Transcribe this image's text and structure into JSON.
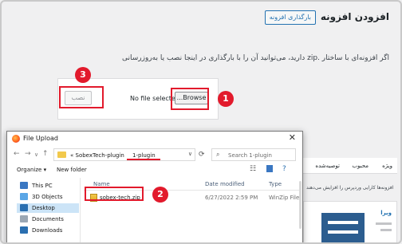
{
  "wp": {
    "title": "افزودن افزونه",
    "upload_button": "بارگذاری افزونه",
    "description": "اگر افزونه‌ای با ساختار .zip دارید، می‌توانید آن را با بارگذاری در اینجا نصب یا به‌روزرسانی",
    "install_button": "نصب",
    "no_file": "No file selected.",
    "browse": "...Browse",
    "tabs": [
      "ویژه",
      "محبوب",
      "توصیه‌شده"
    ],
    "note": "افزونه‌ها کارایی وردپرس را افزایش می‌دهند",
    "card_name": "ویرا"
  },
  "badges": [
    "1",
    "2",
    "3"
  ],
  "highlight_color": "#e21a2c",
  "dialog": {
    "title": "File Upload",
    "breadcrumb": [
      "« SobexTech-plugin",
      "1-plugin"
    ],
    "search_placeholder": "Search 1-plugin",
    "organize": "Organize ▾",
    "new_folder": "New folder",
    "columns": {
      "name": "Name",
      "date": "Date modified",
      "type": "Type"
    },
    "files": [
      {
        "name": "sobex-tech.zip",
        "date": "6/27/2022 2:59 PM",
        "type": "WinZip File"
      }
    ],
    "nav_items": [
      {
        "label": "This PC",
        "icon": "pc-icon",
        "color": "#3a77c2"
      },
      {
        "label": "3D Objects",
        "icon": "cube-icon",
        "color": "#5aa6e6"
      },
      {
        "label": "Desktop",
        "icon": "desktop-icon",
        "color": "#2a6fb0"
      },
      {
        "label": "Documents",
        "icon": "documents-icon",
        "color": "#9aa7b4"
      },
      {
        "label": "Downloads",
        "icon": "downloads-icon",
        "color": "#2a6fb0"
      }
    ]
  }
}
